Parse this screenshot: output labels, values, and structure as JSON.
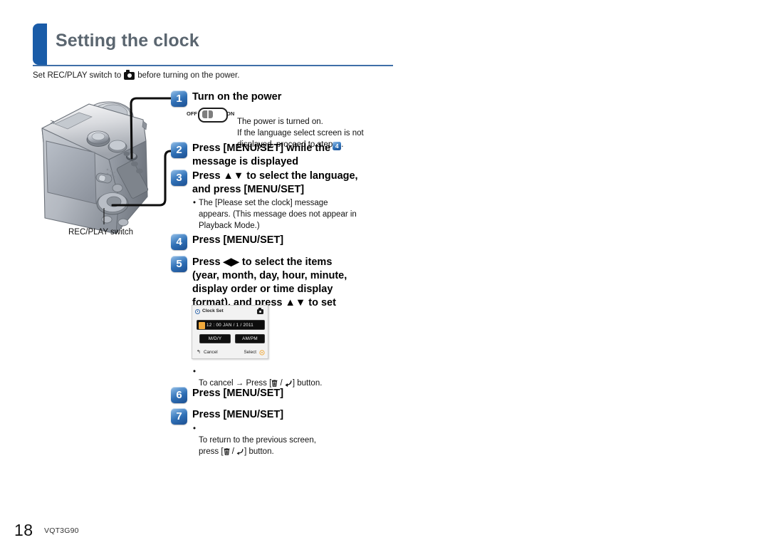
{
  "page": {
    "title": "Setting the clock",
    "intro_prefix": "Set REC/PLAY switch to",
    "intro_suffix": "before turning on the power.",
    "accent_color": "#1a5ca8",
    "title_color": "#5b6670",
    "rule_color": "#3f6fa8"
  },
  "camera": {
    "callout_label": "REC/PLAY switch"
  },
  "power_switch": {
    "off_label": "OFF",
    "on_label": "ON"
  },
  "steps": [
    {
      "number": "1",
      "heading": "Turn on the power",
      "body": "The power is turned on.\nIf the language select screen is not\ndisplayed, proceed to step",
      "body_ref_badge": "4",
      "body_suffix": "."
    },
    {
      "number": "2",
      "heading": "Press [MENU/SET] while the\nmessage is displayed"
    },
    {
      "number": "3",
      "heading": "Press ▲▼ to select the language,\nand press [MENU/SET]",
      "bullet": "The [Please set the clock] message\nappears. (This message does not appear in\nPlayback Mode.)"
    },
    {
      "number": "4",
      "heading": "Press [MENU/SET]"
    },
    {
      "number": "5",
      "heading": "Press ◀▶ to select the items\n(year, month, day, hour, minute,\ndisplay order or time display\nformat), and press ▲▼ to set",
      "bullet_prefix": "To cancel → Press [",
      "bullet_sep": " / ",
      "bullet_suffix": "] button."
    },
    {
      "number": "6",
      "heading": "Press [MENU/SET]"
    },
    {
      "number": "7",
      "heading": "Press [MENU/SET]",
      "bullet_prefix": "To return to the previous screen,\npress [",
      "bullet_sep": " / ",
      "bullet_suffix": "] button."
    }
  ],
  "lcd_screen": {
    "title": "Clock Set",
    "time_value": "12 : 00    JAN  /  1  /  2011",
    "format_button": "M/D/Y",
    "ampm_button": "AM/PM",
    "cancel_label": "Cancel",
    "select_label": "Select",
    "highlight_color": "#f0a93c"
  },
  "footer": {
    "page_number": "18",
    "document_code": "VQT3G90"
  }
}
